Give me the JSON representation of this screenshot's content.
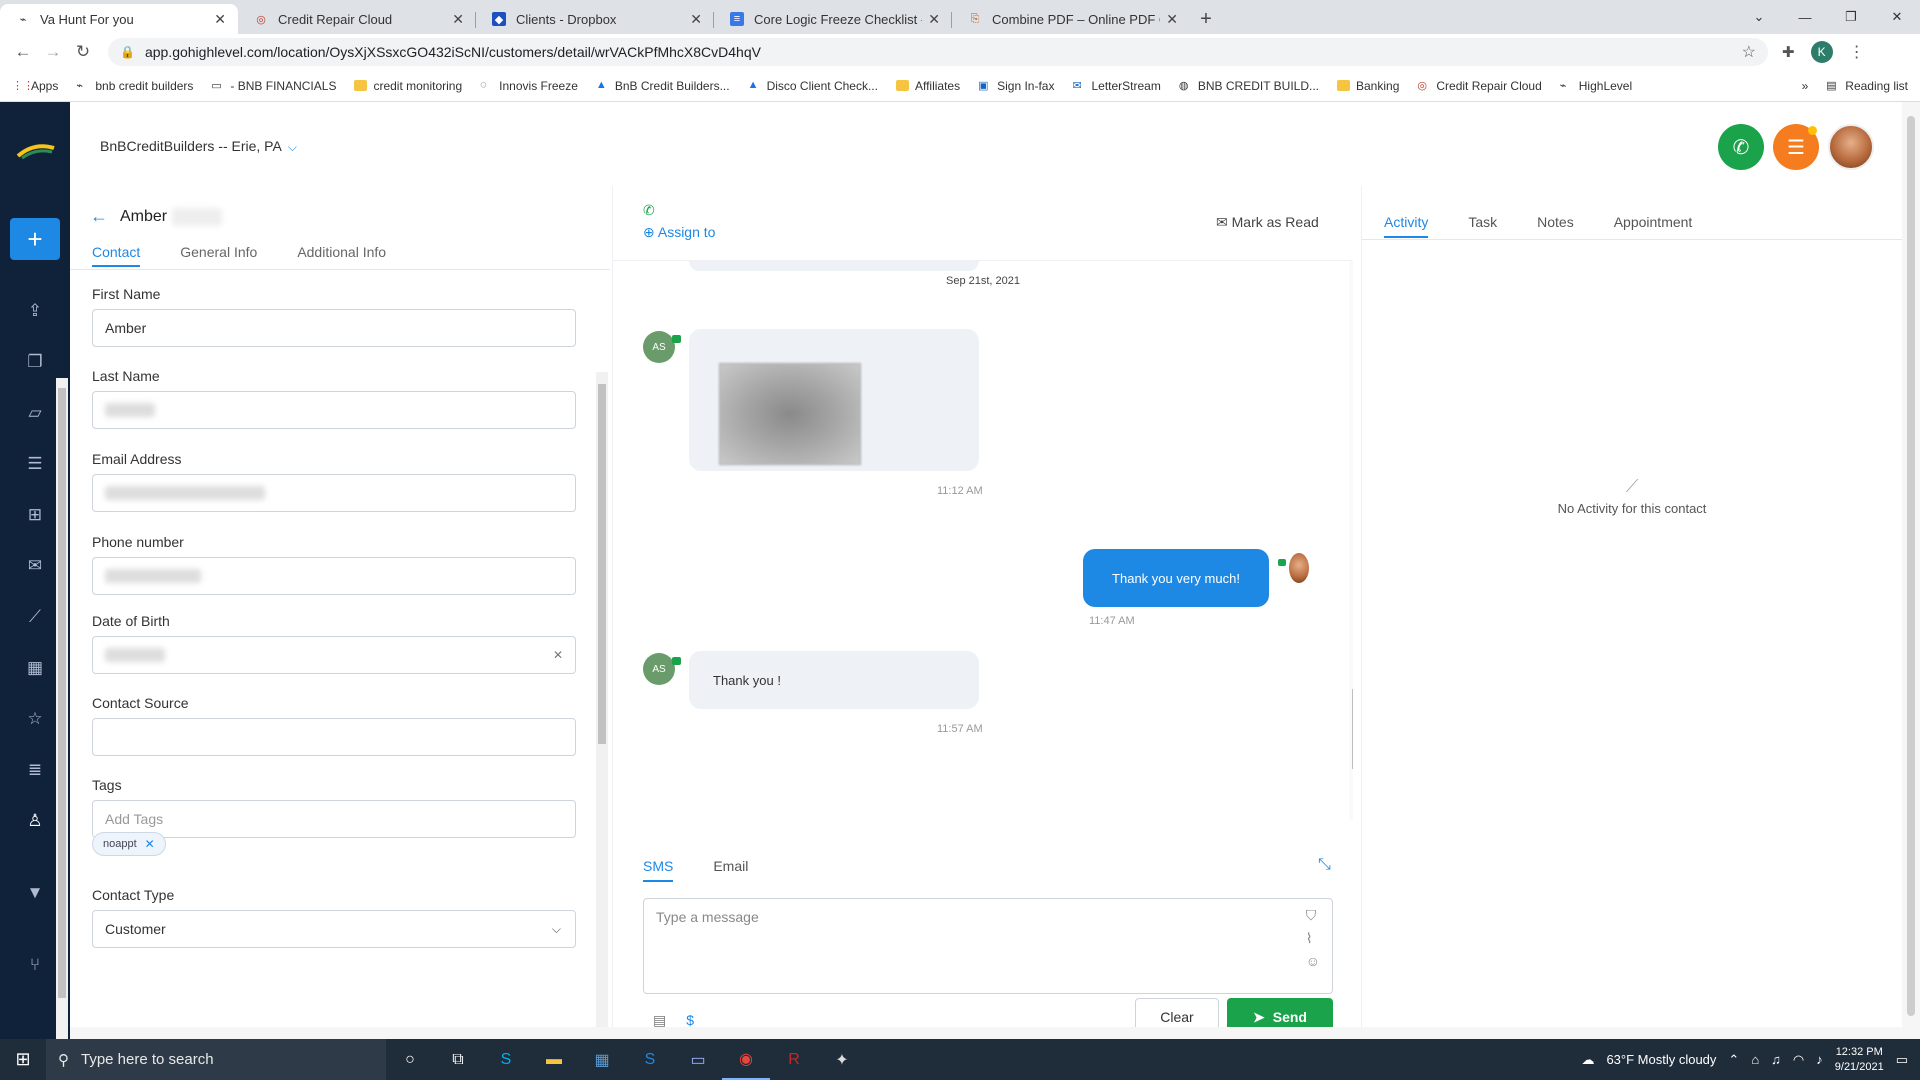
{
  "browser": {
    "tabs": [
      {
        "title": "Va Hunt For you",
        "active": true
      },
      {
        "title": "Credit Repair Cloud",
        "active": false
      },
      {
        "title": "Clients - Dropbox",
        "active": false
      },
      {
        "title": "Core Logic Freeze Checklist - Go",
        "active": false
      },
      {
        "title": "Combine PDF – Online PDF Com",
        "active": false
      }
    ],
    "url": "app.gohighlevel.com/location/OysXjXSsxcGO432iScNI/customers/detail/wrVACkPfMhcX8CvD4hqV",
    "profile_initial": "K",
    "bookmarks": [
      "Apps",
      "bnb credit builders",
      "- BNB FINANCIALS",
      "credit monitoring",
      "Innovis Freeze",
      "BnB Credit Builders...",
      "Disco Client Check...",
      "Affiliates",
      "Sign In-fax",
      "LetterStream",
      "BNB CREDIT BUILD...",
      "Banking",
      "Credit Repair Cloud",
      "HighLevel"
    ],
    "reading_list": "Reading list"
  },
  "header": {
    "location": "BnBCreditBuilders -- Erie, PA"
  },
  "contact": {
    "first_name_display": "Amber",
    "tabs": [
      "Contact",
      "General Info",
      "Additional Info"
    ],
    "fields": {
      "first_name_label": "First Name",
      "first_name_value": "Amber",
      "last_name_label": "Last Name",
      "email_label": "Email Address",
      "phone_label": "Phone number",
      "dob_label": "Date of Birth",
      "source_label": "Contact Source",
      "tags_label": "Tags",
      "tags_placeholder": "Add Tags",
      "tag_values": [
        "noappt"
      ],
      "type_label": "Contact Type",
      "type_value": "Customer"
    }
  },
  "conversation": {
    "assign_label": "Assign to",
    "mark_read_label": "Mark as Read",
    "date_chip": "Sep 21st, 2021",
    "messages": [
      {
        "from": "AS",
        "kind": "image",
        "time": "11:12 AM"
      },
      {
        "from": "me",
        "kind": "text",
        "text": "Thank you very much!",
        "time": "11:47 AM"
      },
      {
        "from": "AS",
        "kind": "text",
        "text": "Thank you !",
        "time": "11:57 AM"
      }
    ],
    "composer": {
      "tabs": [
        "SMS",
        "Email"
      ],
      "placeholder": "Type a message",
      "clear_label": "Clear",
      "send_label": "Send"
    }
  },
  "activity": {
    "tabs": [
      "Activity",
      "Task",
      "Notes",
      "Appointment"
    ],
    "empty_text": "No Activity for this contact"
  },
  "taskbar": {
    "search_placeholder": "Type here to search",
    "weather": "63°F  Mostly cloudy",
    "time": "12:32 PM",
    "date": "9/21/2021"
  },
  "colors": {
    "accent": "#1e88e5",
    "send_green": "#1aa34a",
    "call_green": "#1aa34a",
    "menu_orange": "#f57c1f",
    "nav_bg": "#10213a"
  }
}
